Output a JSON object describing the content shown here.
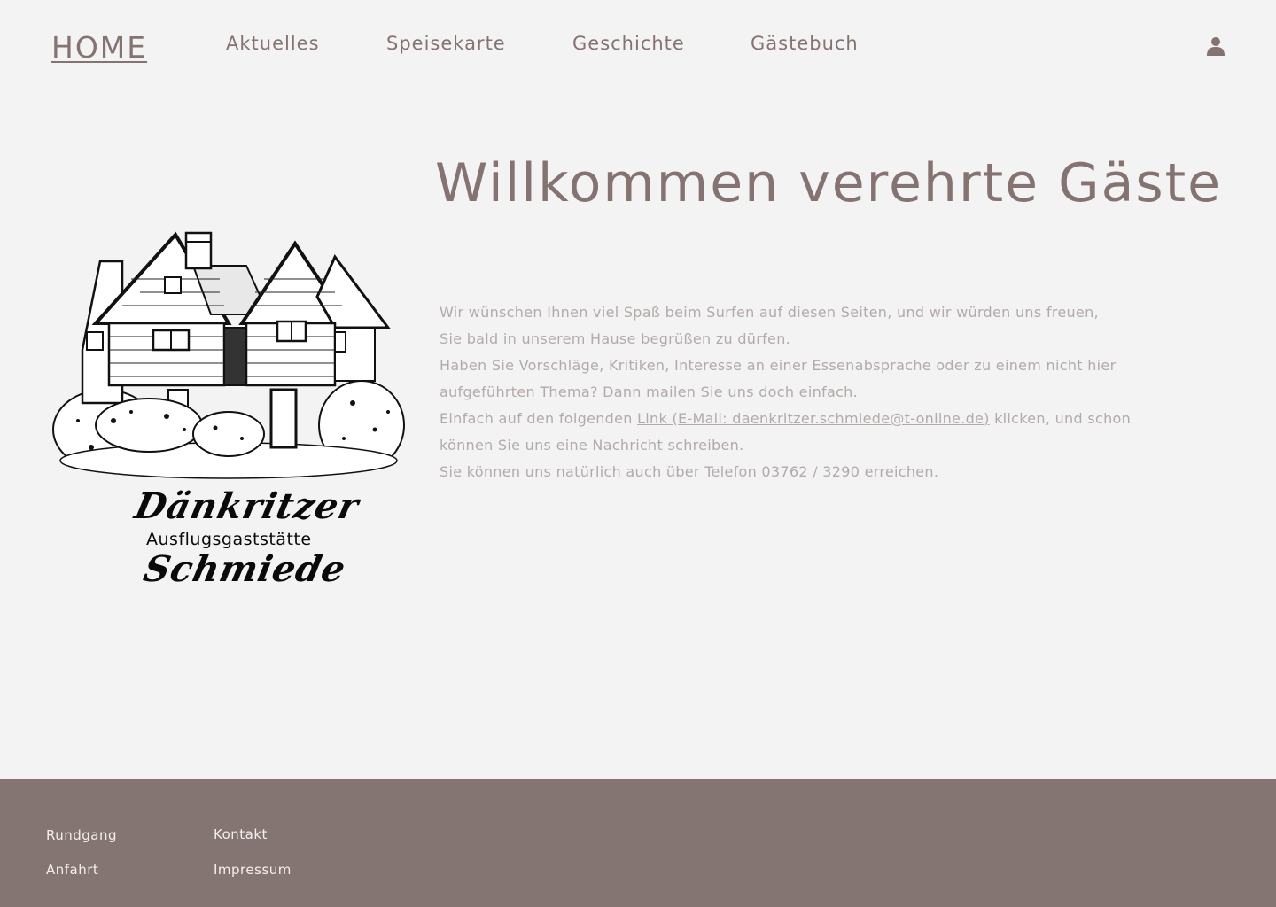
{
  "nav": {
    "home": "HOME",
    "aktuelles": "Aktuelles",
    "speisekarte": "Speisekarte",
    "geschichte": "Geschichte",
    "gaestebuch": "Gästebuch",
    "user_icon": "user-icon"
  },
  "logo": {
    "name_top": "Dänkritzer",
    "subtitle": "Ausflugsgaststätte",
    "name_bottom": "Schmiede"
  },
  "main": {
    "headline": "Willkommen verehrte Gäste",
    "lines": {
      "l1": "Wir wünschen Ihnen viel Spaß beim Surfen auf diesen Seiten, und wir würden uns freuen,",
      "l2": "Sie bald in unserem Hause begrüßen zu dürfen.",
      "l3": "Haben Sie Vorschläge, Kritiken, Interesse an einer Essenabsprache oder zu einem nicht hier",
      "l4": "aufgeführten Thema? Dann mailen Sie uns doch einfach.",
      "l5_before": "Einfach auf den folgenden ",
      "l5_link": "Link (E-Mail: daenkritzer.schmiede@t-online.de)",
      "l5_after": " klicken, und schon",
      "l6": "können Sie uns eine Nachricht schreiben.",
      "l7": "Sie können uns natürlich auch über Telefon 03762 / 3290 erreichen."
    }
  },
  "footer": {
    "rundgang": "Rundgang",
    "anfahrt": "Anfahrt",
    "kontakt": "Kontakt",
    "impressum": "Impressum"
  },
  "colors": {
    "background": "#f3f3f3",
    "accent": "#857371",
    "body_text": "#b3aaa9",
    "footer_bg": "#857572",
    "footer_text": "#f4efee"
  }
}
